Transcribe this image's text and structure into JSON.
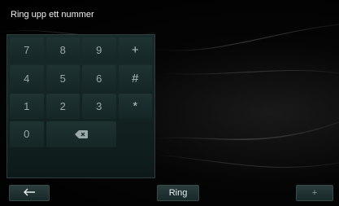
{
  "header": {
    "title": "Ring upp ett nummer"
  },
  "keypad": {
    "keys": [
      "7",
      "8",
      "9",
      "+",
      "4",
      "5",
      "6",
      "#",
      "1",
      "2",
      "3",
      "*",
      "0"
    ],
    "backspace_icon": "backspace-icon"
  },
  "bottombar": {
    "back_icon": "arrow-left-icon",
    "ring_label": "Ring",
    "add_label": "+"
  },
  "colors": {
    "accent": "#1c2f2f",
    "text": "#9aa8a8"
  }
}
